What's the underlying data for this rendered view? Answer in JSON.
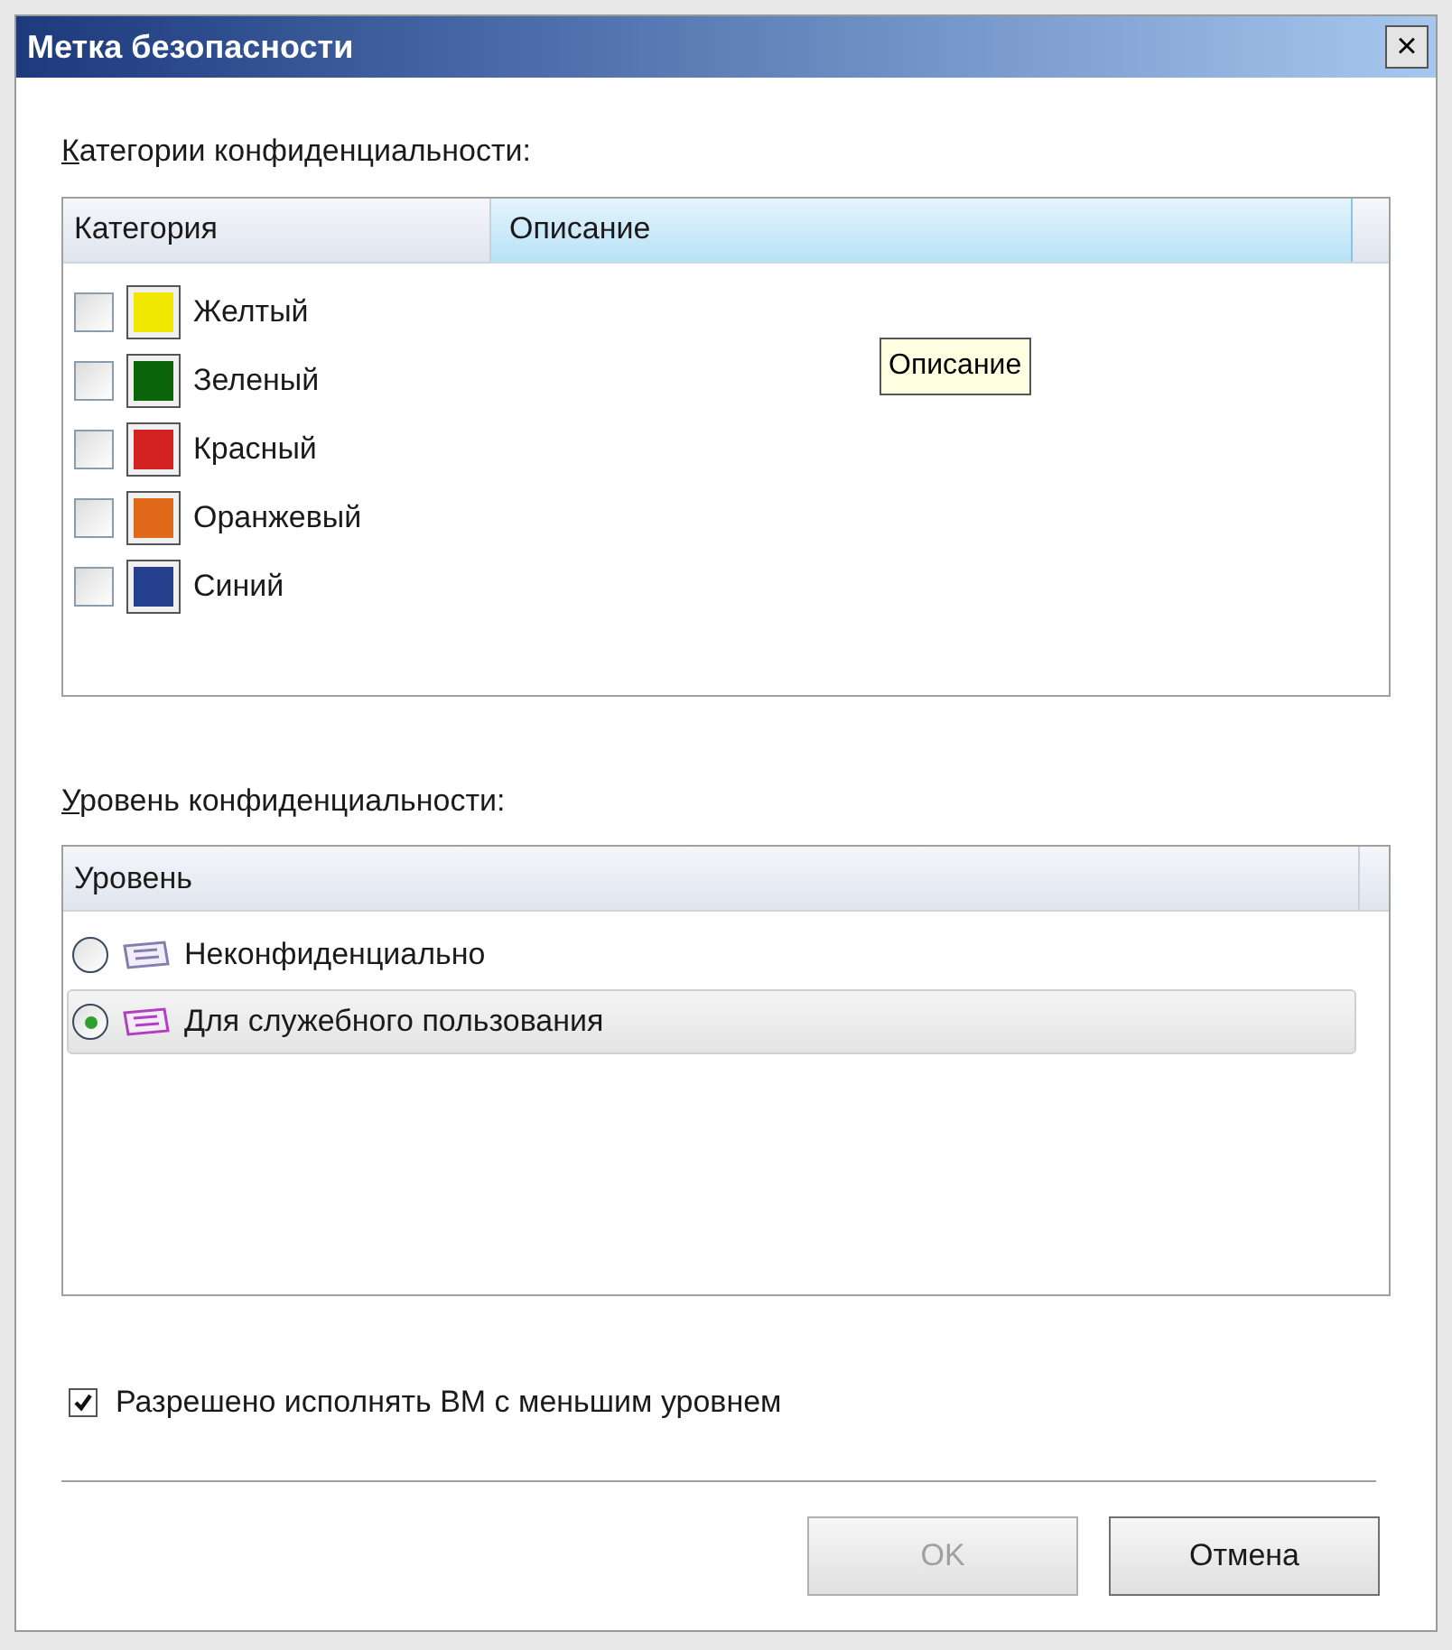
{
  "window": {
    "title": "Метка безопасности",
    "close": "×"
  },
  "categories": {
    "label": "Категории конфиденциальности:",
    "access_key_underlined": true,
    "columns": [
      "Категория",
      "Описание"
    ],
    "tooltip": "Описание",
    "rows": [
      {
        "name": "Желтый",
        "checked": false,
        "color": "#f0e800"
      },
      {
        "name": "Зеленый",
        "checked": false,
        "color": "#0a640a"
      },
      {
        "name": "Красный",
        "checked": false,
        "color": "#d42222"
      },
      {
        "name": "Оранжевый",
        "checked": false,
        "color": "#e06a1a"
      },
      {
        "name": "Синий",
        "checked": false,
        "color": "#24408c"
      }
    ]
  },
  "levels": {
    "label": "Уровень конфиденциальности:",
    "access_key_underlined": true,
    "columns": [
      "Уровень"
    ],
    "rows": [
      {
        "name": "Неконфиденциально",
        "selected": false,
        "color": "#8080b0"
      },
      {
        "name": "Для служебного пользования",
        "selected": true,
        "color": "#b040c0"
      }
    ]
  },
  "allow_lower": {
    "label": "Разрешено исполнять ВМ с меньшим уровнем",
    "checked": true
  },
  "buttons": [
    {
      "label": "OK",
      "disabled": true
    },
    {
      "label": "Отмена",
      "disabled": false
    }
  ]
}
